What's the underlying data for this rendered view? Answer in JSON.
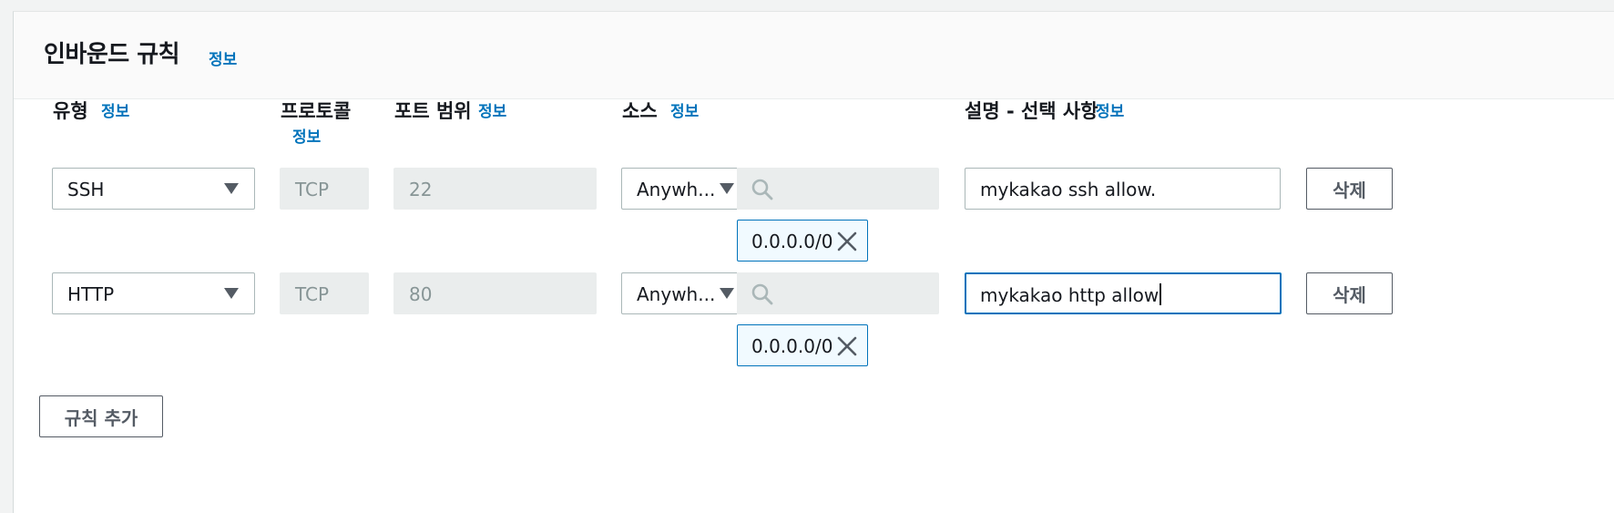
{
  "panel": {
    "title": "인바운드 규칙",
    "title_info": "정보"
  },
  "columns": {
    "type": {
      "label": "유형",
      "info": "정보"
    },
    "protocol": {
      "label": "프로토콜",
      "info": "정보"
    },
    "port_range": {
      "label": "포트 범위",
      "info": "정보"
    },
    "source": {
      "label": "소스",
      "info": "정보"
    },
    "description": {
      "label": "설명 - 선택 사항",
      "info": "정보"
    }
  },
  "rules": [
    {
      "type": "SSH",
      "protocol": "TCP",
      "port": "22",
      "source_type": "Anywh...",
      "search_placeholder": "",
      "cidr": "0.0.0.0/0",
      "description": "mykakao ssh allow.",
      "delete_label": "삭제"
    },
    {
      "type": "HTTP",
      "protocol": "TCP",
      "port": "80",
      "source_type": "Anywh...",
      "search_placeholder": "",
      "cidr": "0.0.0.0/0",
      "description": "mykakao http allow",
      "delete_label": "삭제"
    }
  ],
  "add_rule_label": "규칙 추가",
  "icons": {
    "search": "search-icon",
    "remove": "close-icon",
    "dropdown": "caret-down-icon"
  },
  "colors": {
    "link": "#0073bb",
    "focus_border": "#0073bb",
    "token_bg": "#f1faff",
    "disabled_bg": "#eaeded"
  }
}
